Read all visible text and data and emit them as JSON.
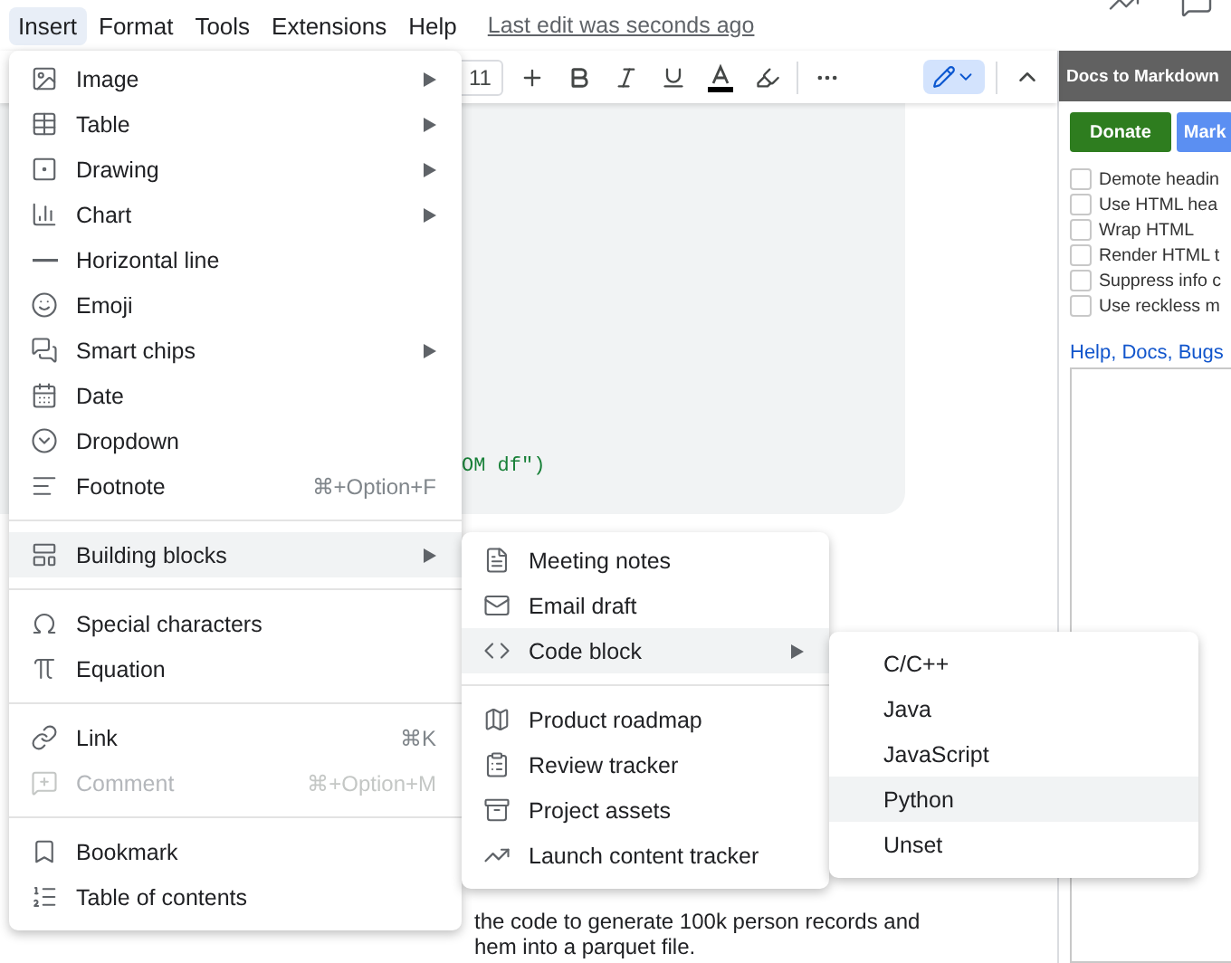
{
  "menu_bar": {
    "items": [
      {
        "label": "Insert",
        "selected": true
      },
      {
        "label": "Format",
        "selected": false
      },
      {
        "label": "Tools",
        "selected": false
      },
      {
        "label": "Extensions",
        "selected": false
      },
      {
        "label": "Help",
        "selected": false
      }
    ],
    "last_edit": "Last edit was seconds ago"
  },
  "toolbar": {
    "font_size": "11"
  },
  "editor": {
    "code_fragment": "OM df\")",
    "body_lines": [
      "the code to generate 100k person records and",
      "hem into a parquet file."
    ]
  },
  "insert_menu": {
    "sections": [
      [
        {
          "label": "Image",
          "submenu": true,
          "selected": false,
          "disabled": false
        },
        {
          "label": "Table",
          "submenu": true,
          "selected": false,
          "disabled": false
        },
        {
          "label": "Drawing",
          "submenu": true,
          "selected": false,
          "disabled": false
        },
        {
          "label": "Chart",
          "submenu": true,
          "selected": false,
          "disabled": false
        },
        {
          "label": "Horizontal line",
          "submenu": false,
          "selected": false,
          "disabled": false
        },
        {
          "label": "Emoji",
          "submenu": false,
          "selected": false,
          "disabled": false
        },
        {
          "label": "Smart chips",
          "submenu": true,
          "selected": false,
          "disabled": false
        },
        {
          "label": "Date",
          "submenu": false,
          "selected": false,
          "disabled": false
        },
        {
          "label": "Dropdown",
          "submenu": false,
          "selected": false,
          "disabled": false
        },
        {
          "label": "Footnote",
          "shortcut": "⌘+Option+F",
          "submenu": false,
          "selected": false,
          "disabled": false
        }
      ],
      [
        {
          "label": "Building blocks",
          "submenu": true,
          "selected": true,
          "disabled": false
        }
      ],
      [
        {
          "label": "Special characters",
          "submenu": false,
          "selected": false,
          "disabled": false
        },
        {
          "label": "Equation",
          "submenu": false,
          "selected": false,
          "disabled": false
        }
      ],
      [
        {
          "label": "Link",
          "shortcut": "⌘K",
          "submenu": false,
          "selected": false,
          "disabled": false
        },
        {
          "label": "Comment",
          "shortcut": "⌘+Option+M",
          "submenu": false,
          "selected": false,
          "disabled": true
        }
      ],
      [
        {
          "label": "Bookmark",
          "submenu": false,
          "selected": false,
          "disabled": false
        },
        {
          "label": "Table of contents",
          "submenu": false,
          "selected": false,
          "disabled": false
        }
      ]
    ]
  },
  "building_blocks_menu": {
    "sections": [
      [
        {
          "label": "Meeting notes",
          "submenu": false,
          "selected": false
        },
        {
          "label": "Email draft",
          "submenu": false,
          "selected": false
        },
        {
          "label": "Code block",
          "submenu": true,
          "selected": true
        }
      ],
      [
        {
          "label": "Product roadmap",
          "submenu": false,
          "selected": false
        },
        {
          "label": "Review tracker",
          "submenu": false,
          "selected": false
        },
        {
          "label": "Project assets",
          "submenu": false,
          "selected": false
        },
        {
          "label": "Launch content tracker",
          "submenu": false,
          "selected": false
        }
      ]
    ]
  },
  "code_block_menu": {
    "items": [
      {
        "label": "C/C++",
        "selected": false
      },
      {
        "label": "Java",
        "selected": false
      },
      {
        "label": "JavaScript",
        "selected": false
      },
      {
        "label": "Python",
        "selected": true
      },
      {
        "label": "Unset",
        "selected": false
      }
    ]
  },
  "sidebar": {
    "title": "Docs to Markdown",
    "buttons": [
      {
        "label": "Donate",
        "kind": "donate"
      },
      {
        "label": "Mark",
        "kind": "primary"
      }
    ],
    "options": [
      {
        "label": "Demote headin",
        "checked": false
      },
      {
        "label": "Use HTML hea",
        "checked": false
      },
      {
        "label": "Wrap HTML",
        "checked": false
      },
      {
        "label": "Render HTML t",
        "checked": false
      },
      {
        "label": "Suppress info c",
        "checked": false
      },
      {
        "label": "Use reckless m",
        "checked": false
      }
    ],
    "links": [
      {
        "label": "Help",
        "trailing": ","
      },
      {
        "label": "Docs",
        "trailing": ","
      },
      {
        "label": "Bugs"
      }
    ]
  }
}
